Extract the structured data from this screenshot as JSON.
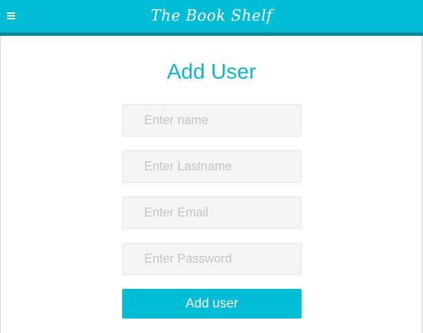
{
  "header": {
    "menu_icon": "hamburger-menu-icon",
    "brand_title": "The Book Shelf",
    "background_color": "#00bcd4",
    "border_color": "#00899c"
  },
  "form": {
    "title": "Add User",
    "title_color": "#12b5cb",
    "fields": {
      "name": {
        "placeholder": "Enter name",
        "value": ""
      },
      "lastname": {
        "placeholder": "Enter Lastname",
        "value": ""
      },
      "email": {
        "placeholder": "Enter Email",
        "value": ""
      },
      "password": {
        "placeholder": "Enter Password",
        "value": ""
      }
    },
    "submit_label": "Add user",
    "submit_color": "#00bcd4"
  }
}
